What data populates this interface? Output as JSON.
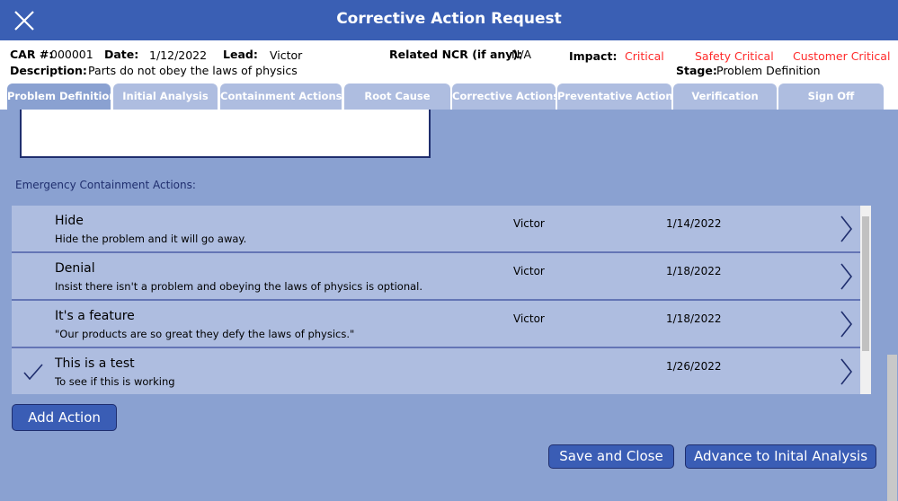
{
  "header": {
    "title": "Corrective Action Request",
    "close_icon": "close-icon"
  },
  "info": {
    "car_label": "CAR #:",
    "car_value": "000001",
    "date_label": "Date:",
    "date_value": "1/12/2022",
    "lead_label": "Lead:",
    "lead_value": "Victor",
    "ncr_label": "Related NCR (if any):",
    "ncr_value": "N/A",
    "impact_label": "Impact:",
    "impact_values": [
      "Critical",
      "Safety Critical",
      "Customer Critical"
    ],
    "impact_color": "#ff2a2a",
    "description_label": "Description:",
    "description_value": "Parts do not obey the laws of physics",
    "stage_label": "Stage:",
    "stage_value": "Problem Definition"
  },
  "tabs": [
    {
      "label": "Problem Definition",
      "active": true
    },
    {
      "label": "Initial Analysis"
    },
    {
      "label": "Containment Actions"
    },
    {
      "label": "Root Cause"
    },
    {
      "label": "Corrective Actions"
    },
    {
      "label": "Preventative Actions"
    },
    {
      "label": "Verification"
    },
    {
      "label": "Sign Off"
    }
  ],
  "section_label": "Emergency Containment Actions:",
  "actions": [
    {
      "title": "Hide",
      "description": "Hide the problem and it will go away.",
      "person": "Victor",
      "date": "1/14/2022",
      "checked": false
    },
    {
      "title": "Denial",
      "description": "Insist there isn't a problem and obeying the laws of physics is optional.",
      "person": "Victor",
      "date": "1/18/2022",
      "checked": false
    },
    {
      "title": "It's a feature",
      "description": "\"Our products are so great they defy the laws of physics.\"",
      "person": "Victor",
      "date": "1/18/2022",
      "checked": false
    },
    {
      "title": "This is a test",
      "description": "To see if this is working",
      "person": "",
      "date": "1/26/2022",
      "checked": true
    }
  ],
  "buttons": {
    "add_action": "Add Action",
    "save_close": "Save and Close",
    "advance": "Advance to Inital Analysis"
  },
  "colors": {
    "header": "#3a5fb4",
    "background": "#8aa1d1",
    "row": "#aebde0",
    "button": "#3a5db5"
  }
}
